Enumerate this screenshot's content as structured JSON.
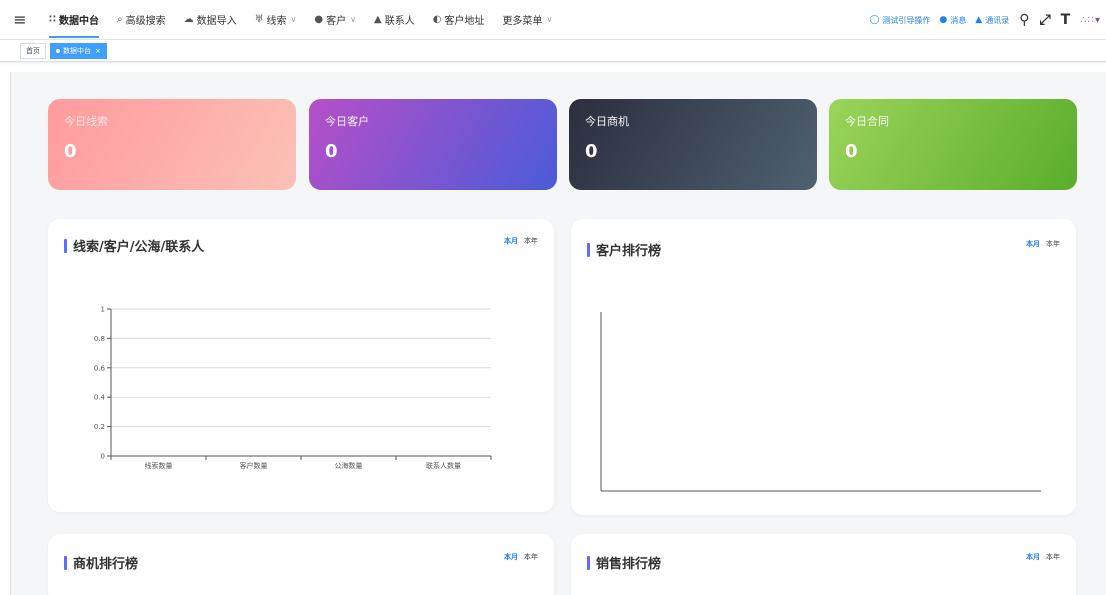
{
  "navbar": {
    "hamburger_icon": "hamburger-icon",
    "menu": [
      {
        "label": "数据中台",
        "icon": "∷",
        "active": true,
        "arrow": false
      },
      {
        "label": "高级搜索",
        "icon": "⌕",
        "active": false,
        "arrow": false
      },
      {
        "label": "数据导入",
        "icon": "☁",
        "active": false,
        "arrow": false
      },
      {
        "label": "线索",
        "icon": "♅",
        "active": false,
        "arrow": true
      },
      {
        "label": "客户",
        "icon": "●",
        "active": false,
        "arrow": true
      },
      {
        "label": "联系人",
        "icon": "▲",
        "active": false,
        "arrow": false
      },
      {
        "label": "客户地址",
        "icon": "◐",
        "active": false,
        "arrow": false
      },
      {
        "label": "更多菜单",
        "icon": "",
        "active": false,
        "arrow": true
      }
    ],
    "right": {
      "guide": "测试引导操作",
      "message": "消息",
      "contacts": "通讯录"
    }
  },
  "tags": {
    "home": "首页",
    "active": "数据中台"
  },
  "stats": [
    {
      "label": "今日线索",
      "value": "0"
    },
    {
      "label": "今日客户",
      "value": "0"
    },
    {
      "label": "今日商机",
      "value": "0"
    },
    {
      "label": "今日合同",
      "value": "0"
    }
  ],
  "period": {
    "month": "本月",
    "year": "本年"
  },
  "panels": {
    "leads": "线索/客户/公海/联系人",
    "customer_rank": "客户排行榜",
    "opportunity_rank": "商机排行榜",
    "sales_rank": "销售排行榜"
  },
  "colors": {
    "accent": "#409eff"
  },
  "chart_data": {
    "type": "bar",
    "categories": [
      "线索数量",
      "客户数量",
      "公海数量",
      "联系人数量"
    ],
    "values": [
      0,
      0,
      0,
      0
    ],
    "yticks": [
      "0",
      "0.2",
      "0.4",
      "0.6",
      "0.8",
      "1"
    ],
    "ylim": [
      0,
      1
    ],
    "grid": true
  }
}
